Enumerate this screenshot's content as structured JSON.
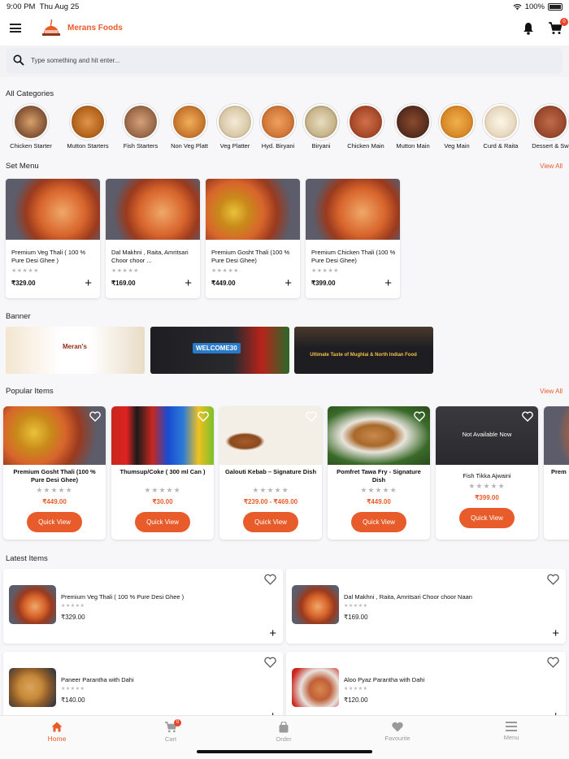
{
  "status": {
    "time": "9:00 PM",
    "date": "Thu Aug 25",
    "battery": "100%"
  },
  "header": {
    "brand": "Merans Foods",
    "cart_count": "0"
  },
  "search": {
    "placeholder": "Type something and hit enter..."
  },
  "categories": {
    "title": "All Categories",
    "items": [
      {
        "label": "Chicken Starter",
        "color": "#8a5a3a"
      },
      {
        "label": "Mutton Starters",
        "color": "#b5651d"
      },
      {
        "label": "Fish Starters",
        "color": "#9c6b4a"
      },
      {
        "label": "Non Veg Platt",
        "color": "#c9782f"
      },
      {
        "label": "Veg Platter",
        "color": "#d9c9a8"
      },
      {
        "label": "Hyd. Biryani",
        "color": "#d0783a"
      },
      {
        "label": "Biryani",
        "color": "#c7b48a"
      },
      {
        "label": "Chicken Main",
        "color": "#a84a2a"
      },
      {
        "label": "Mutton Main",
        "color": "#5a2e1e"
      },
      {
        "label": "Veg Main",
        "color": "#d98a2a"
      },
      {
        "label": "Curd & Raita",
        "color": "#e6d9c2"
      },
      {
        "label": "Dessert & Sw",
        "color": "#9a4a2e"
      }
    ]
  },
  "set_menu": {
    "title": "Set Menu",
    "view_all": "View All",
    "items": [
      {
        "name": "Premium Veg Thali ( 100 % Pure Desi Ghee )",
        "price": "₹329.00"
      },
      {
        "name": "Dal Makhni , Raita, Amritsari Choor choor ...",
        "price": "₹169.00"
      },
      {
        "name": "Premium Gosht Thali (100 % Pure Desi Ghee)",
        "price": "₹449.00"
      },
      {
        "name": "Premium Chicken Thali (100 % Pure Desi Ghee)",
        "price": "₹399.00"
      }
    ]
  },
  "banner": {
    "title": "Banner",
    "items": [
      {
        "text": "Meran's"
      },
      {
        "text": "WELCOME30"
      },
      {
        "text": "Ultimate Taste of Mughlai & North Indian Food"
      }
    ]
  },
  "popular": {
    "title": "Popular Items",
    "view_all": "View All",
    "quick_view": "Quick View",
    "not_available": "Not Available Now",
    "items": [
      {
        "name": "Premium Gosht Thali (100 % Pure Desi Ghee)",
        "price": "₹449.00"
      },
      {
        "name": "Thumsup/Coke ( 300 ml Can )",
        "price": "₹30.00"
      },
      {
        "name": "Galouti Kebab – Signature Dish",
        "price": "₹239.00 - ₹469.00"
      },
      {
        "name": "Pomfret Tawa Fry  - Signature Dish",
        "price": "₹449.00"
      },
      {
        "name": "Fish Tikka Ajwaini",
        "price": "₹399.00"
      },
      {
        "name": "Prem",
        "price": ""
      }
    ]
  },
  "latest": {
    "title": "Latest Items",
    "items": [
      {
        "name": "Premium Veg Thali ( 100 % Pure Desi Ghee )",
        "price": "₹329.00"
      },
      {
        "name": "Dal Makhni , Raita, Amritsari Choor choor Naan",
        "price": "₹169.00"
      },
      {
        "name": "Paneer Parantha with Dahi",
        "price": "₹140.00"
      },
      {
        "name": "Aloo Pyaz Parantha with Dahi",
        "price": "₹120.00"
      }
    ]
  },
  "tabs": {
    "home": "Home",
    "cart": "Cart",
    "order": "Order",
    "favourite": "Favourite",
    "menu": "Menu",
    "cart_count": "0"
  },
  "colors": {
    "accent": "#e85b2a"
  }
}
